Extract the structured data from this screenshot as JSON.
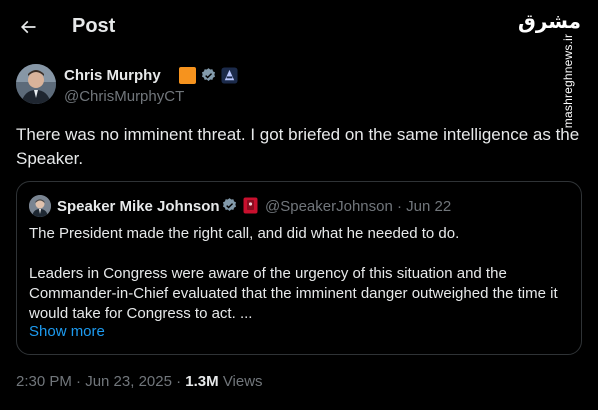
{
  "header": {
    "title": "Post"
  },
  "watermark": {
    "logo_text": "مشرق",
    "url": "mashreghnews.ir"
  },
  "post": {
    "author": {
      "display_name": "Chris Murphy",
      "handle": "@ChrisMurphyCT"
    },
    "text": "There was no imminent threat. I got briefed on the same intelligence as the Speaker.",
    "timestamp": "2:30 PM · Jun 23, 2025",
    "separator": " · ",
    "views_count": "1.3M",
    "views_label": "Views"
  },
  "quote": {
    "author_name": "Speaker Mike Johnson",
    "meta": "@SpeakerJohnson · Jun 22",
    "paragraph1": "The President made the right call, and did what he needed to do.",
    "paragraph2": "Leaders in Congress were aware of the urgency of this situation and the Commander-in-Chief evaluated that the imminent danger outweighed the time it would take for Congress to act. ...",
    "show_more": "Show more"
  },
  "colors": {
    "background": "#000000",
    "text_primary": "#e7e9ea",
    "text_secondary": "#71767b",
    "accent_blue": "#1d9bf0",
    "border": "#2f3336",
    "badge_orange": "#f6931e",
    "badge_red": "#c8102e"
  }
}
